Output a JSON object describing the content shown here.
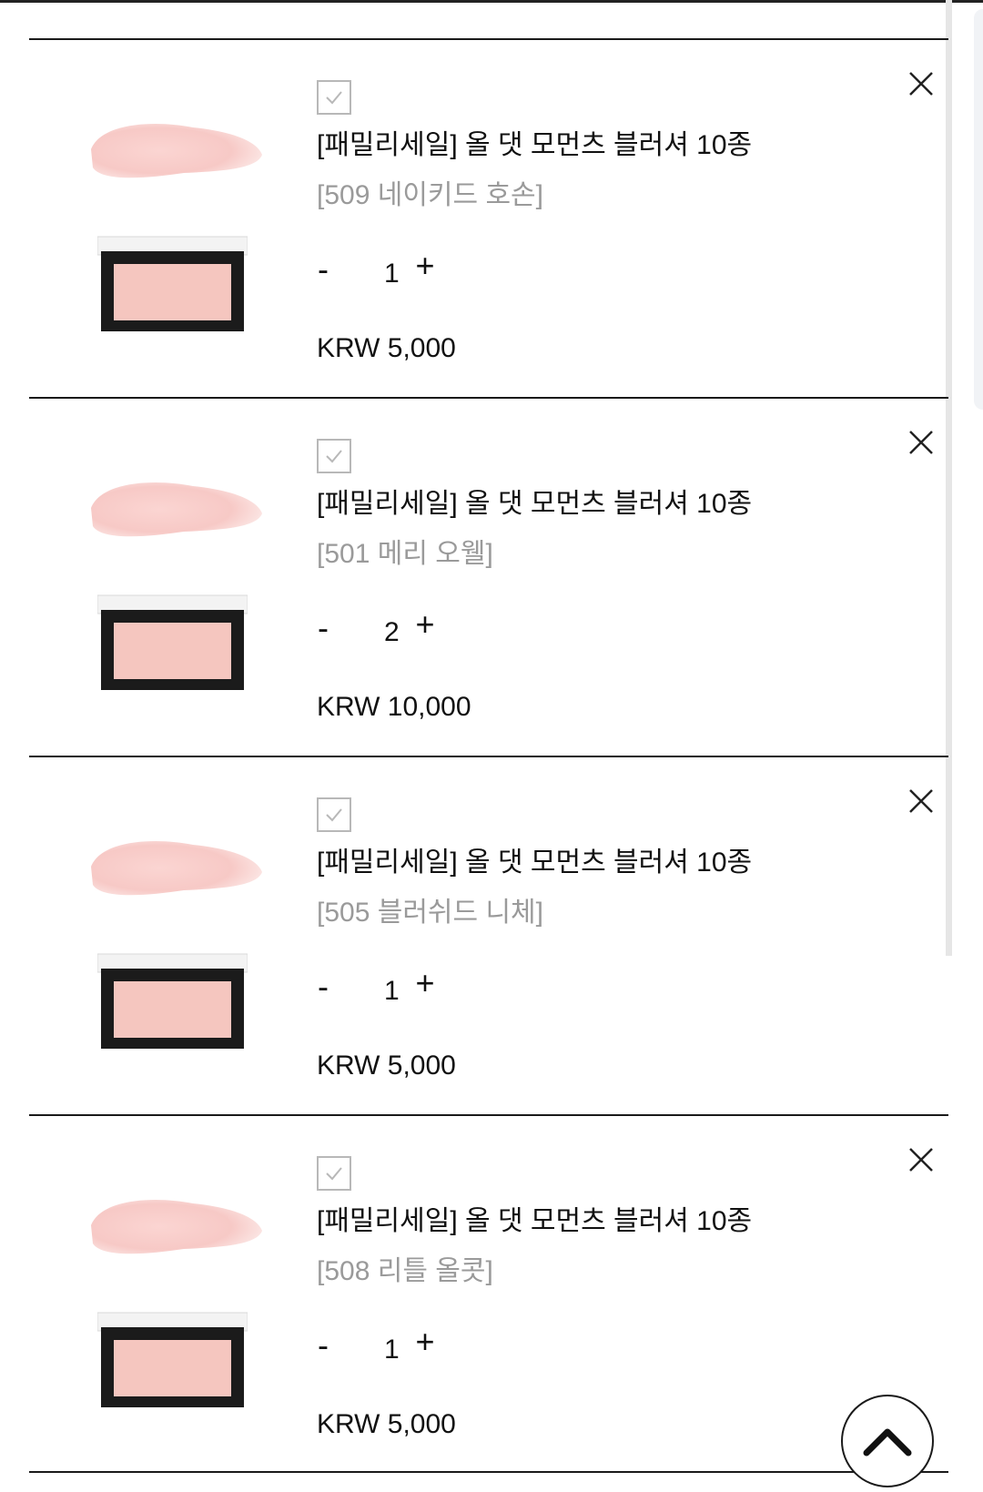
{
  "cart": {
    "items": [
      {
        "name": "[패밀리세일] 올 댓 모먼츠 블러셔 10종",
        "option": "[509 네이키드 호손]",
        "quantity": "1",
        "price": "KRW 5,000"
      },
      {
        "name": "[패밀리세일] 올 댓 모먼츠 블러셔 10종",
        "option": "[501 메리 오웰]",
        "quantity": "2",
        "price": "KRW 10,000"
      },
      {
        "name": "[패밀리세일] 올 댓 모먼츠 블러셔 10종",
        "option": "[505 블러쉬드 니체]",
        "quantity": "1",
        "price": "KRW 5,000"
      },
      {
        "name": "[패밀리세일] 올 댓 모먼츠 블러셔 10종",
        "option": "[508 리틀 올콧]",
        "quantity": "1",
        "price": "KRW 5,000"
      }
    ],
    "minus_label": "-",
    "plus_label": "+"
  },
  "icons": {
    "checkbox": "check-icon",
    "remove": "close-icon",
    "scroll_top": "chevron-up-icon"
  },
  "colors": {
    "swatch": "#f7c9c6",
    "compact_frame": "#1b1b1b",
    "blush": "#f5c6bf",
    "muted_text": "#9a9a9a"
  }
}
